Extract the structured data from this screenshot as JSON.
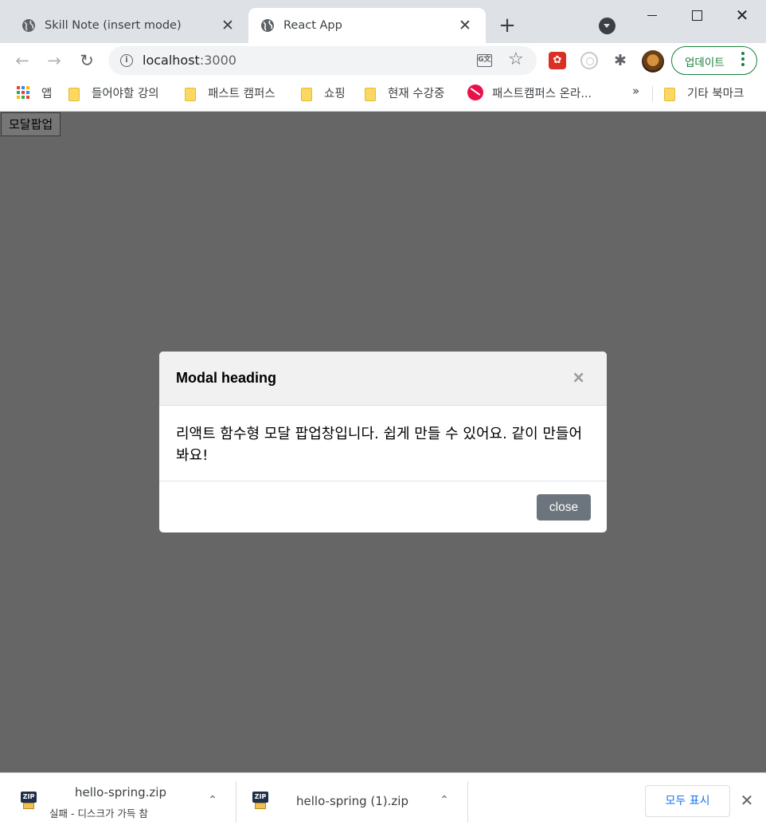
{
  "browser": {
    "tabs": [
      {
        "title": "Skill Note (insert mode)",
        "active": false
      },
      {
        "title": "React App",
        "active": true
      }
    ],
    "tab_close_glyph": "✕",
    "new_tab_glyph": "+",
    "window_close_glyph": "✕",
    "back_glyph": "←",
    "forward_glyph": "→",
    "reload_glyph": "↻",
    "address": {
      "host": "localhost",
      "port": ":3000"
    },
    "translate_glyph": "G文",
    "star_glyph": "☆",
    "extension_glyph": "✱",
    "update_button": "업데이트"
  },
  "bookmarks": {
    "items": [
      {
        "label": "앱",
        "icon": "apps-grid-icon"
      },
      {
        "label": "들어야할 강의",
        "icon": "folder-icon"
      },
      {
        "label": "패스트 캠퍼스",
        "icon": "folder-icon"
      },
      {
        "label": "쇼핑",
        "icon": "folder-icon"
      },
      {
        "label": "현재 수강중",
        "icon": "folder-icon"
      },
      {
        "label": "패스트캠퍼스 온라...",
        "icon": "fastcampus-logo-icon"
      }
    ],
    "more": "»",
    "other": "기타 북마크"
  },
  "page": {
    "open_button": "모달팝업",
    "modal": {
      "heading": "Modal heading",
      "close_x": "×",
      "body": "리액트 함수형 모달 팝업창입니다. 쉽게 만들 수 있어요. 같이 만들어봐요!",
      "footer_button": "close"
    }
  },
  "downloads": {
    "items": [
      {
        "filename": "hello-spring.zip",
        "status": "실패 - 디스크가 가득 참"
      },
      {
        "filename": "hello-spring (1).zip",
        "status": ""
      }
    ],
    "zip_label": "ZIP",
    "chevron_glyph": "⌃",
    "show_all": "모두 표시",
    "close_glyph": "✕"
  },
  "colors": {
    "overlay": "#666666",
    "accent_green": "#188038",
    "show_all_blue": "#1a73e8",
    "close_button_bg": "#6c757d"
  }
}
